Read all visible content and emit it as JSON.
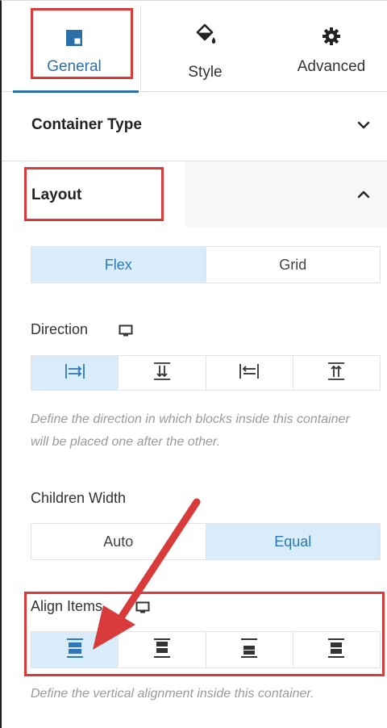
{
  "tabs": [
    {
      "label": "General",
      "icon": "layout-icon",
      "active": true
    },
    {
      "label": "Style",
      "icon": "paint-bucket-icon",
      "active": false
    },
    {
      "label": "Advanced",
      "icon": "gear-icon",
      "active": false
    }
  ],
  "sections": {
    "container_type": {
      "title": "Container Type",
      "icon": "chevron-down-icon"
    },
    "layout": {
      "title": "Layout",
      "icon": "chevron-up-icon"
    }
  },
  "layout": {
    "type_options": [
      "Flex",
      "Grid"
    ],
    "type_selected": "Flex",
    "direction": {
      "label": "Direction",
      "options": [
        "row-icon",
        "column-icon",
        "row-reverse-icon",
        "column-reverse-icon"
      ],
      "selected": "row-icon",
      "help": "Define the direction in which blocks inside this container will be placed one after the other."
    },
    "children_width": {
      "label": "Children Width",
      "options": [
        "Auto",
        "Equal"
      ],
      "selected": "Equal"
    },
    "align_items": {
      "label": "Align Items",
      "options": [
        "align-stretch-icon",
        "align-start-icon",
        "align-end-icon",
        "align-center-icon"
      ],
      "selected": "align-stretch-icon",
      "help": "Define the vertical alignment inside this container."
    }
  },
  "colors": {
    "accent": "#2e78b8",
    "active_bg": "#d8ecfa",
    "highlight": "#d93a3a"
  }
}
